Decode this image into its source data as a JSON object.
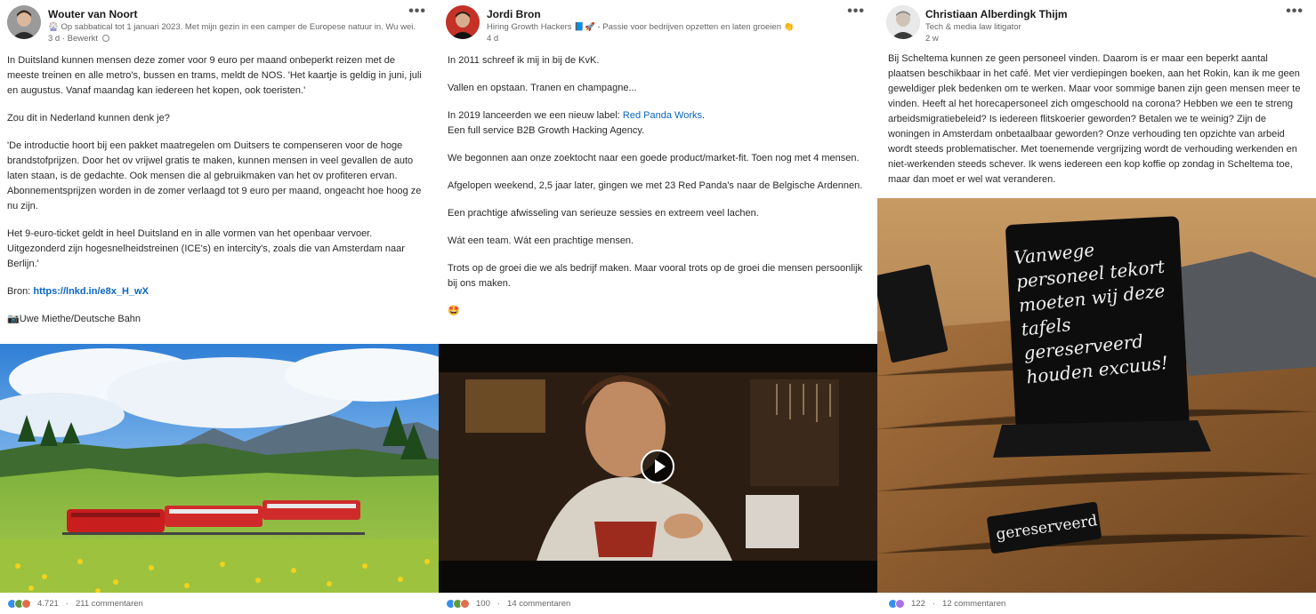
{
  "posts": [
    {
      "author": "Wouter van Noort",
      "subtitle": "🎡 Op sabbatical tot 1 januari 2023. Met mijn gezin in een camper de Europese natuur in. Wu wei.",
      "meta": "3 d · Bewerkt",
      "more": "•••",
      "paragraphs": [
        "In Duitsland kunnen mensen deze zomer voor 9 euro per maand onbeperkt reizen met de meeste treinen en alle metro's, bussen en trams, meldt de NOS. 'Het kaartje is geldig in juni, juli en augustus. Vanaf maandag kan iedereen het kopen, ook toeristen.'",
        "Zou dit in Nederland kunnen denk je?",
        "'De introductie hoort bij een pakket maatregelen om Duitsers te compenseren voor de hoge brandstofprijzen. Door het ov vrijwel gratis te maken, kunnen mensen in veel gevallen de auto laten staan, is de gedachte. Ook mensen die al gebruikmaken van het ov profiteren ervan. Abonnementsprijzen worden in de zomer verlaagd tot 9 euro per maand, ongeacht hoe hoog ze nu zijn.",
        "Het 9-euro-ticket geldt in heel Duitsland en in alle vormen van het openbaar vervoer. Uitgezonderd zijn hogesnelheidstreinen (ICE's) en intercity's, zoals die van Amsterdam naar Berlijn.'"
      ],
      "source_label": "Bron: ",
      "source_link": "https://lnkd.in/e8x_H_wX",
      "credit": "📷Uwe Miethe/Deutsche Bahn",
      "reaction_count": "4.721",
      "comments": "211 commentaren"
    },
    {
      "author": "Jordi Bron",
      "subtitle": "Hiring Growth Hackers 📘🚀 - Passie voor bedrijven opzetten en laten groeien 👏",
      "meta": "4 d",
      "more": "•••",
      "p1": "In 2011 schreef ik mij in bij de KvK.",
      "p2": "Vallen en opstaan. Tranen en champagne...",
      "p3_prefix": "In 2019 lanceerden we een nieuw label: ",
      "p3_link": "Red Panda Works",
      "p3_suffix": ".",
      "p3_line2": "Een full service B2B Growth Hacking Agency.",
      "p4": "We begonnen aan onze zoektocht naar een goede product/market-fit. Toen nog met 4 mensen.",
      "p5": "Afgelopen weekend, 2,5 jaar later, gingen we met 23 Red Panda's naar de Belgische Ardennen.",
      "p6": "Een prachtige afwisseling van serieuze sessies en extreem veel lachen.",
      "p7": "Wát een team. Wát een prachtige mensen.",
      "p8": "Trots op de groei die we als bedrijf maken. Maar vooral trots op de groei die mensen persoonlijk bij ons maken.",
      "p9": "🤩",
      "reaction_count": "100",
      "comments": "14 commentaren"
    },
    {
      "author": "Christiaan Alberdingk Thijm",
      "subtitle": "Tech & media law litigator",
      "meta": "2 w",
      "more": "•••",
      "text": "Bij Scheltema kunnen ze geen personeel vinden. Daarom is er maar een beperkt aantal plaatsen beschikbaar in het café. Met vier verdiepingen boeken, aan het Rokin, kan ik me geen geweldiger plek bedenken om te werken. Maar voor sommige banen zijn geen mensen meer te vinden. Heeft al het horecapersoneel zich omgeschoold na corona? Hebben we een te streng arbeidsmigratiebeleid? Is iedereen flitskoerier geworden? Betalen we te weinig? Zijn de woningen in Amsterdam onbetaalbaar geworden? Onze verhouding ten opzichte van arbeid wordt steeds problematischer. Met toenemende vergrijzing wordt de verhouding werkenden en niet-werkenden steeds schever. Ik wens iedereen een kop koffie op zondag in Scheltema toe, maar dan moet er wel wat veranderen.",
      "sign_text": "Vanwege personeel tekort moeten wij deze tafels gereserveerd houden excuus!",
      "plaque_text": "gereserveerd",
      "reaction_count": "122",
      "comments": "12 commentaren"
    }
  ]
}
